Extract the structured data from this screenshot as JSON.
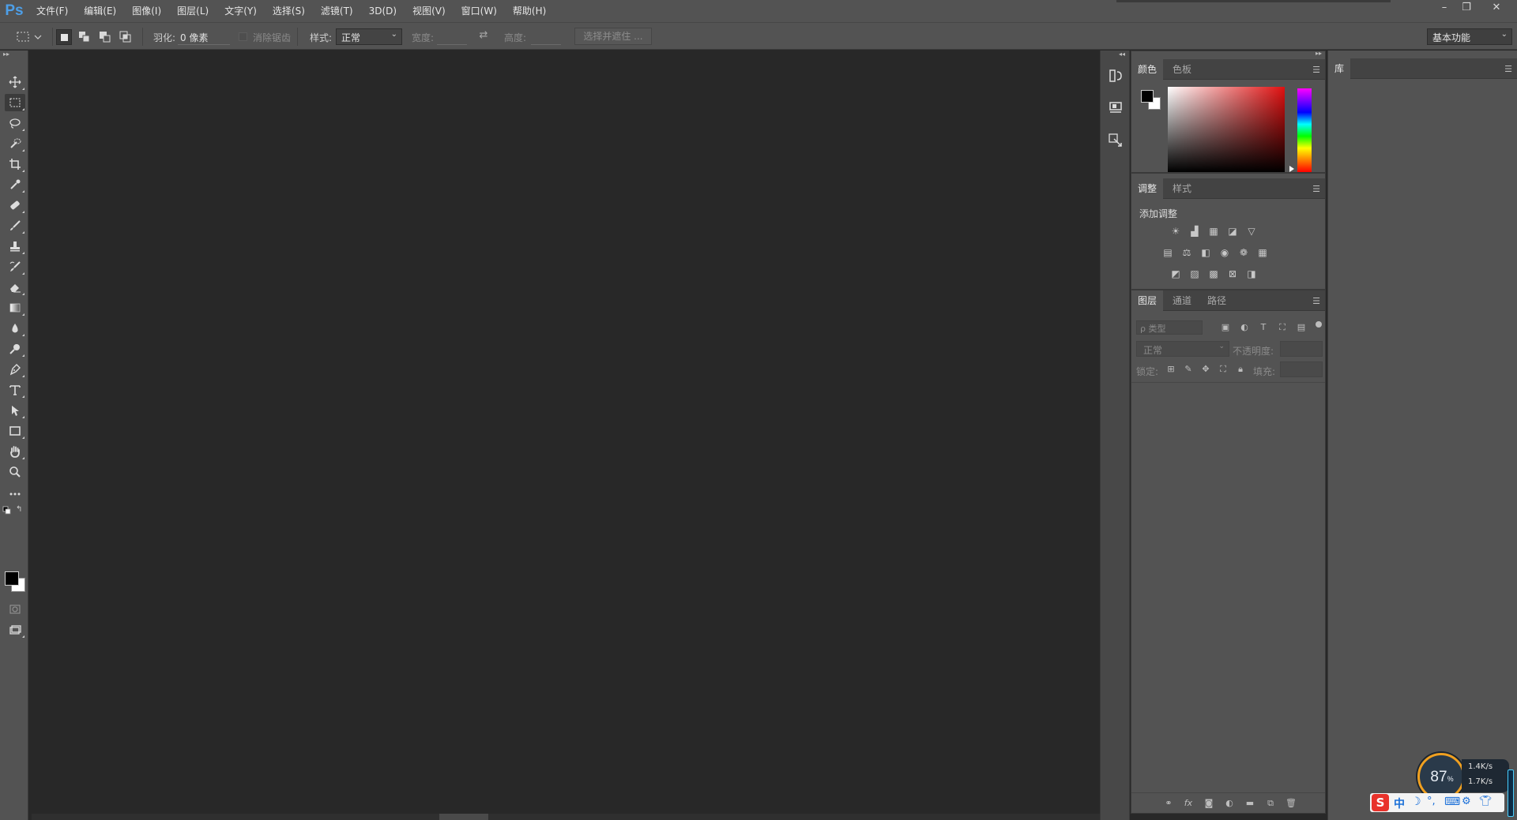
{
  "app": {
    "logo": "Ps",
    "menus": [
      "文件(F)",
      "编辑(E)",
      "图像(I)",
      "图层(L)",
      "文字(Y)",
      "选择(S)",
      "滤镜(T)",
      "3D(D)",
      "视图(V)",
      "窗口(W)",
      "帮助(H)"
    ],
    "window_controls": {
      "minimize": "–",
      "restore": "❐",
      "close": "✕"
    }
  },
  "options": {
    "feather_label": "羽化:",
    "feather_value": "0 像素",
    "antialias_label": "消除锯齿",
    "style_label": "样式:",
    "style_value": "正常",
    "width_label": "宽度:",
    "height_label": "高度:",
    "select_mask_btn": "选择并遮住 ...",
    "workspace": "基本功能"
  },
  "panels": {
    "color": {
      "tabs": [
        "颜色",
        "色板"
      ]
    },
    "adjust": {
      "tabs": [
        "调整",
        "样式"
      ],
      "heading": "添加调整"
    },
    "layers": {
      "tabs": [
        "图层",
        "通道",
        "路径"
      ],
      "filter_placeholder": "ρ 类型",
      "blend_mode": "正常",
      "opacity_label": "不透明度:",
      "lock_label": "锁定:",
      "fill_label": "填充:"
    },
    "library": {
      "tab": "库"
    }
  },
  "systray": {
    "percent": "87",
    "percent_unit": "%",
    "up_speed": "1.4K/s",
    "down_speed": "1.7K/s",
    "ime_label": "中",
    "ime_logo": "S"
  },
  "colors": {
    "menubar": "#535353",
    "canvas": "#282828",
    "accent": "#4d9fe8",
    "gauge_ring": "#f0a020"
  }
}
